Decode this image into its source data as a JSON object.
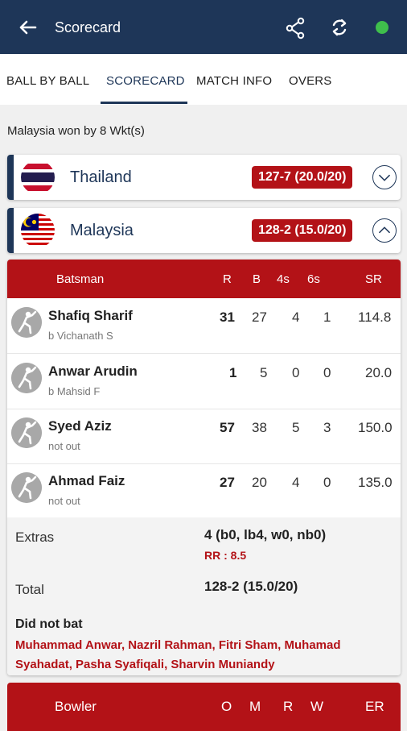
{
  "appbar": {
    "title": "Scorecard",
    "status_color": "#3fbf4c"
  },
  "tabs": [
    "BALL BY BALL",
    "SCORECARD",
    "MATCH INFO",
    "OVERS"
  ],
  "result": "Malaysia won by 8 Wkt(s)",
  "teams": [
    {
      "name": "Thailand",
      "score": "127-7 (20.0/20)",
      "expanded": false
    },
    {
      "name": "Malaysia",
      "score": "128-2 (15.0/20)",
      "expanded": true
    }
  ],
  "batting": {
    "headers": {
      "batsman": "Batsman",
      "r": "R",
      "b": "B",
      "fours": "4s",
      "sixes": "6s",
      "sr": "SR"
    },
    "rows": [
      {
        "name": "Shafiq Sharif",
        "dismissal": "b Vichanath S",
        "r": "31",
        "b": "27",
        "fours": "4",
        "sixes": "1",
        "sr": "114.8"
      },
      {
        "name": "Anwar Arudin",
        "dismissal": "b Mahsid F",
        "r": "1",
        "b": "5",
        "fours": "0",
        "sixes": "0",
        "sr": "20.0"
      },
      {
        "name": "Syed Aziz",
        "dismissal": "not out",
        "r": "57",
        "b": "38",
        "fours": "5",
        "sixes": "3",
        "sr": "150.0"
      },
      {
        "name": "Ahmad Faiz",
        "dismissal": "not out",
        "r": "27",
        "b": "20",
        "fours": "4",
        "sixes": "0",
        "sr": "135.0"
      }
    ],
    "extras_label": "Extras",
    "extras_value": "4 (b0, lb4, w0, nb0)",
    "run_rate": "RR : 8.5",
    "total_label": "Total",
    "total_value": "128-2 (15.0/20)",
    "dnb_label": "Did not bat",
    "dnb_list": "Muhammad Anwar, Nazril Rahman, Fitri Sham, Muhamad Syahadat, Pasha Syafiqali, Sharvin Muniandy"
  },
  "bowling": {
    "headers": {
      "bowler": "Bowler",
      "o": "O",
      "m": "M",
      "r": "R",
      "w": "W",
      "er": "ER"
    }
  },
  "colors": {
    "navy": "#1e3658",
    "red": "#b31217"
  }
}
